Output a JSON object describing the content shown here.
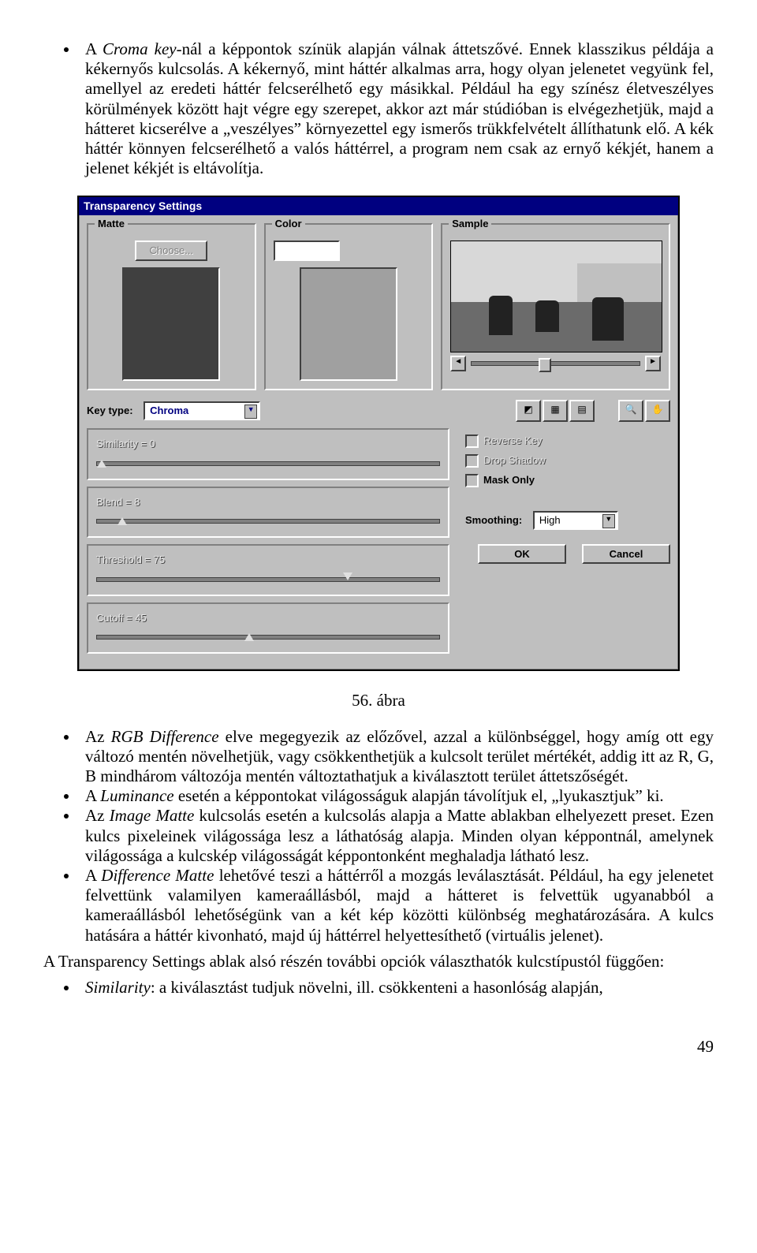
{
  "para1_pre": "A ",
  "para1_it1": "Croma key",
  "para1_post": "-nál a képpontok színük alapján válnak áttetszővé. Ennek klasszikus példája a kékernyős kulcsolás. A kékernyő, mint háttér alkalmas arra, hogy olyan jelenetet vegyünk fel, amellyel az eredeti háttér felcserélhető egy másikkal. Például ha egy színész életveszélyes körülmények között hajt végre egy szerepet, akkor azt már stúdióban is elvégezhetjük, majd a hátteret kicserélve a „veszélyes” környezettel egy ismerős trükkfelvételt állíthatunk elő. A kék háttér könnyen felcserélhető a valós háttérrel, a program nem csak az ernyő kékjét, hanem a jelenet kékjét is eltávolítja.",
  "dialog": {
    "title": "Transparency Settings",
    "matte_label": "Matte",
    "choose_btn": "Choose...",
    "color_label": "Color",
    "sample_label": "Sample",
    "key_type_label": "Key type:",
    "key_type_value": "Chroma",
    "similarity_label": "Similarity = 0",
    "blend_label": "Blend = 8",
    "threshold_label": "Threshold = 75",
    "cutoff_label": "Cutoff = 45",
    "reverse_label": "Reverse Key",
    "drop_label": "Drop Shadow",
    "mask_label": "Mask Only",
    "smoothing_label": "Smoothing:",
    "smoothing_value": "High",
    "ok": "OK",
    "cancel": "Cancel"
  },
  "caption": "56. ábra",
  "b1_pre": "Az ",
  "b1_it": "RGB Difference",
  "b1_post": " elve megegyezik az előzővel, azzal a különbséggel, hogy amíg ott egy változó mentén növelhetjük, vagy csökkenthetjük a kulcsolt terület mértékét, addig itt az R, G, B mindhárom változója mentén változtathatjuk a kiválasztott terület áttetszőségét.",
  "b2_pre": "A ",
  "b2_it": "Luminance",
  "b2_post": " esetén a képpontokat világosságuk alapján távolítjuk el, „lyukasztjuk” ki.",
  "b3_pre": "Az ",
  "b3_it": "Image Matte",
  "b3_post": " kulcsolás esetén a kulcsolás alapja a Matte ablakban elhelyezett preset. Ezen kulcs pixeleinek világossága lesz a láthatóság alapja. Minden olyan képpontnál, amelynek világossága a kulcskép világosságát képpontonként meghaladja látható lesz.",
  "b4_pre": "A ",
  "b4_it": "Difference Matte",
  "b4_post": " lehetővé teszi a háttérről a mozgás leválasztását. Például, ha egy jelenetet felvettünk valamilyen kameraállásból, majd a hátteret is felvettük ugyanabból a kameraállásból lehetőségünk van a két kép közötti különbség meghatározására. A kulcs hatására a háttér kivonható, majd új háttérrel helyettesíthető (virtuális jelenet).",
  "plain": "A Transparency Settings ablak alsó részén további opciók választhatók kulcstípustól függően:",
  "b5_it": "Similarity",
  "b5_post": ": a kiválasztást tudjuk növelni, ill. csökkenteni a hasonlóság alapján,",
  "pagenum": "49"
}
